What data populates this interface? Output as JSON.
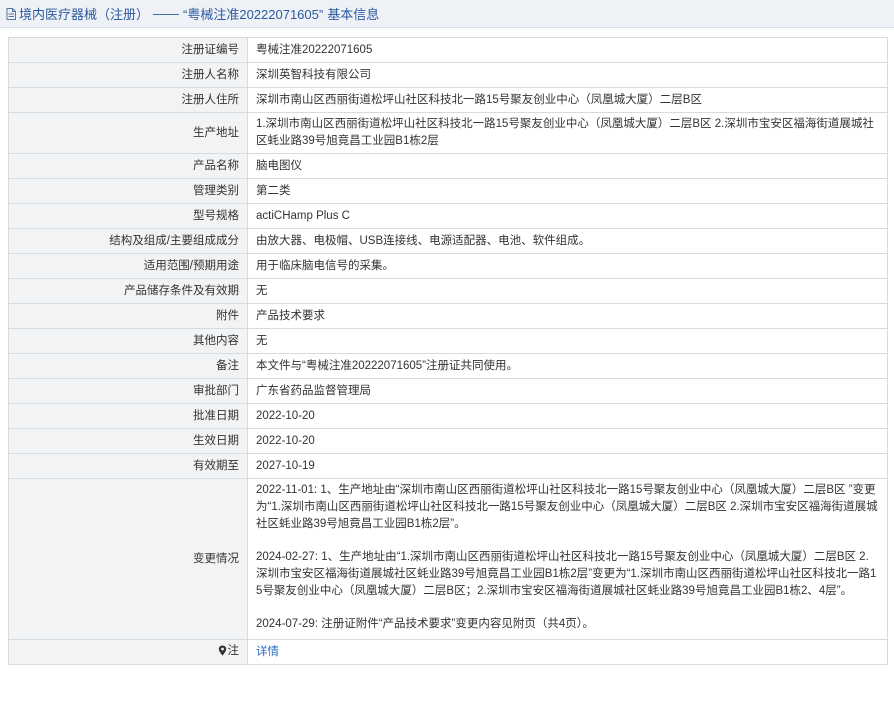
{
  "header": {
    "section": "境内医疗器械（注册）",
    "separator": "——",
    "record": "“粤械注准20222071605”",
    "suffix": "基本信息"
  },
  "rows": {
    "reg_no": {
      "label": "注册证编号",
      "value": "粤械注准20222071605"
    },
    "registrant": {
      "label": "注册人名称",
      "value": "深圳英智科技有限公司"
    },
    "registrant_addr": {
      "label": "注册人住所",
      "value": "深圳市南山区西丽街道松坪山社区科技北一路15号聚友创业中心（凤凰城大厦）二层B区"
    },
    "prod_addr": {
      "label": "生产地址",
      "value": "1.深圳市南山区西丽街道松坪山社区科技北一路15号聚友创业中心（凤凰城大厦）二层B区 2.深圳市宝安区福海街道展城社区蚝业路39号旭竟昌工业园B1栋2层"
    },
    "product_name": {
      "label": "产品名称",
      "value": "脑电图仪"
    },
    "category": {
      "label": "管理类别",
      "value": "第二类"
    },
    "model": {
      "label": "型号规格",
      "value": "actiCHamp Plus C"
    },
    "structure": {
      "label": "结构及组成/主要组成成分",
      "value": "由放大器、电极帽、USB连接线、电源适配器、电池、软件组成。"
    },
    "scope": {
      "label": "适用范围/预期用途",
      "value": "用于临床脑电信号的采集。"
    },
    "storage": {
      "label": "产品储存条件及有效期",
      "value": "无"
    },
    "attachment": {
      "label": "附件",
      "value": "产品技术要求"
    },
    "other": {
      "label": "其他内容",
      "value": "无"
    },
    "remark": {
      "label": "备注",
      "value": "本文件与“粤械注准20222071605”注册证共同使用。"
    },
    "approval_dept": {
      "label": "审批部门",
      "value": "广东省药品监督管理局"
    },
    "approval_date": {
      "label": "批准日期",
      "value": "2022-10-20"
    },
    "effective_date": {
      "label": "生效日期",
      "value": "2022-10-20"
    },
    "expiry": {
      "label": "有效期至",
      "value": "2027-10-19"
    },
    "changes": {
      "label": "变更情况",
      "items": [
        "2022-11-01: 1、生产地址由“深圳市南山区西丽街道松坪山社区科技北一路15号聚友创业中心（凤凰城大厦）二层B区 ”变更为“1.深圳市南山区西丽街道松坪山社区科技北一路15号聚友创业中心（凤凰城大厦）二层B区 2.深圳市宝安区福海街道展城社区蚝业路39号旭竟昌工业园B1栋2层”。",
        "2024-02-27: 1、生产地址由“1.深圳市南山区西丽街道松坪山社区科技北一路15号聚友创业中心（凤凰城大厦）二层B区 2.深圳市宝安区福海街道展城社区蚝业路39号旭竟昌工业园B1栋2层”变更为“1.深圳市南山区西丽街道松坪山社区科技北一路15号聚友创业中心（凤凰城大厦）二层B区；2.深圳市宝安区福海街道展城社区蚝业路39号旭竟昌工业园B1栋2、4层”。",
        "2024-07-29: 注册证附件“产品技术要求”变更内容见附页（共4页）。"
      ]
    },
    "note": {
      "label": "注",
      "link": "详情"
    }
  },
  "colors": {
    "header_bg": "#eef1f6",
    "header_text": "#2c5aa0",
    "label_bg": "#f2f3f5",
    "border": "#d7dbe1",
    "link": "#2b6cc4"
  },
  "icons": [
    "document-icon",
    "pin-icon"
  ]
}
